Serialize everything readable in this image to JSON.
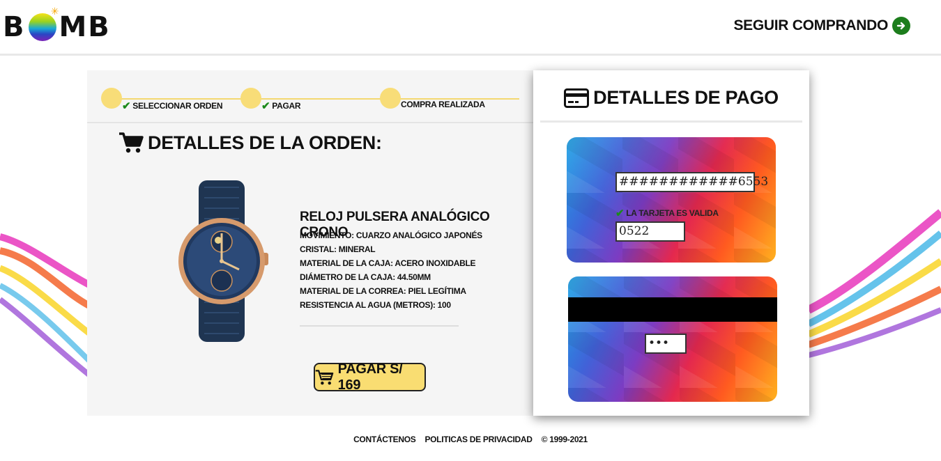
{
  "header": {
    "logo_left": "B",
    "logo_right": "MB",
    "continue_label": "SEGUIR COMPRANDO",
    "continue_icon": "arrow-circle-right-icon"
  },
  "steps": [
    {
      "label": "SELECCIONAR ORDEN",
      "done": true
    },
    {
      "label": "PAGAR",
      "done": true
    },
    {
      "label": "COMPRA REALIZADA",
      "done": false
    }
  ],
  "order": {
    "title": "DETALLES DE LA ORDEN:",
    "title_icon": "cart-icon",
    "product_name": "RELOJ PULSERA ANALÓGICO CRONO",
    "specs": [
      "MOVIMIENTO: CUARZO ANALÓGICO JAPONÉS",
      "CRISTAL: MINERAL",
      "MATERIAL DE LA CAJA: ACERO INOXIDABLE",
      "DIÁMETRO DE LA CAJA: 44.50MM",
      "MATERIAL DE LA CORREA: PIEL LEGÍTIMA",
      "RESISTENCIA AL AGUA (METROS): 100"
    ],
    "pay_button": "PAGAR S/ 169"
  },
  "payment": {
    "title": "DETALLES DE PAGO",
    "title_icon": "credit-card-icon",
    "card_number": "############6553",
    "valid_message": "LA TARJETA ES VALIDA",
    "expiry": "0522",
    "cvv": "•••"
  },
  "footer": {
    "contact": "CONTÁCTENOS",
    "privacy": "POLITICAS DE PRIVACIDAD",
    "copyright": "© 1999-2021"
  },
  "colors": {
    "accent_yellow": "#f9dd72",
    "check_green": "#1c8a1c",
    "panel_bg": "#f5f5f5"
  }
}
